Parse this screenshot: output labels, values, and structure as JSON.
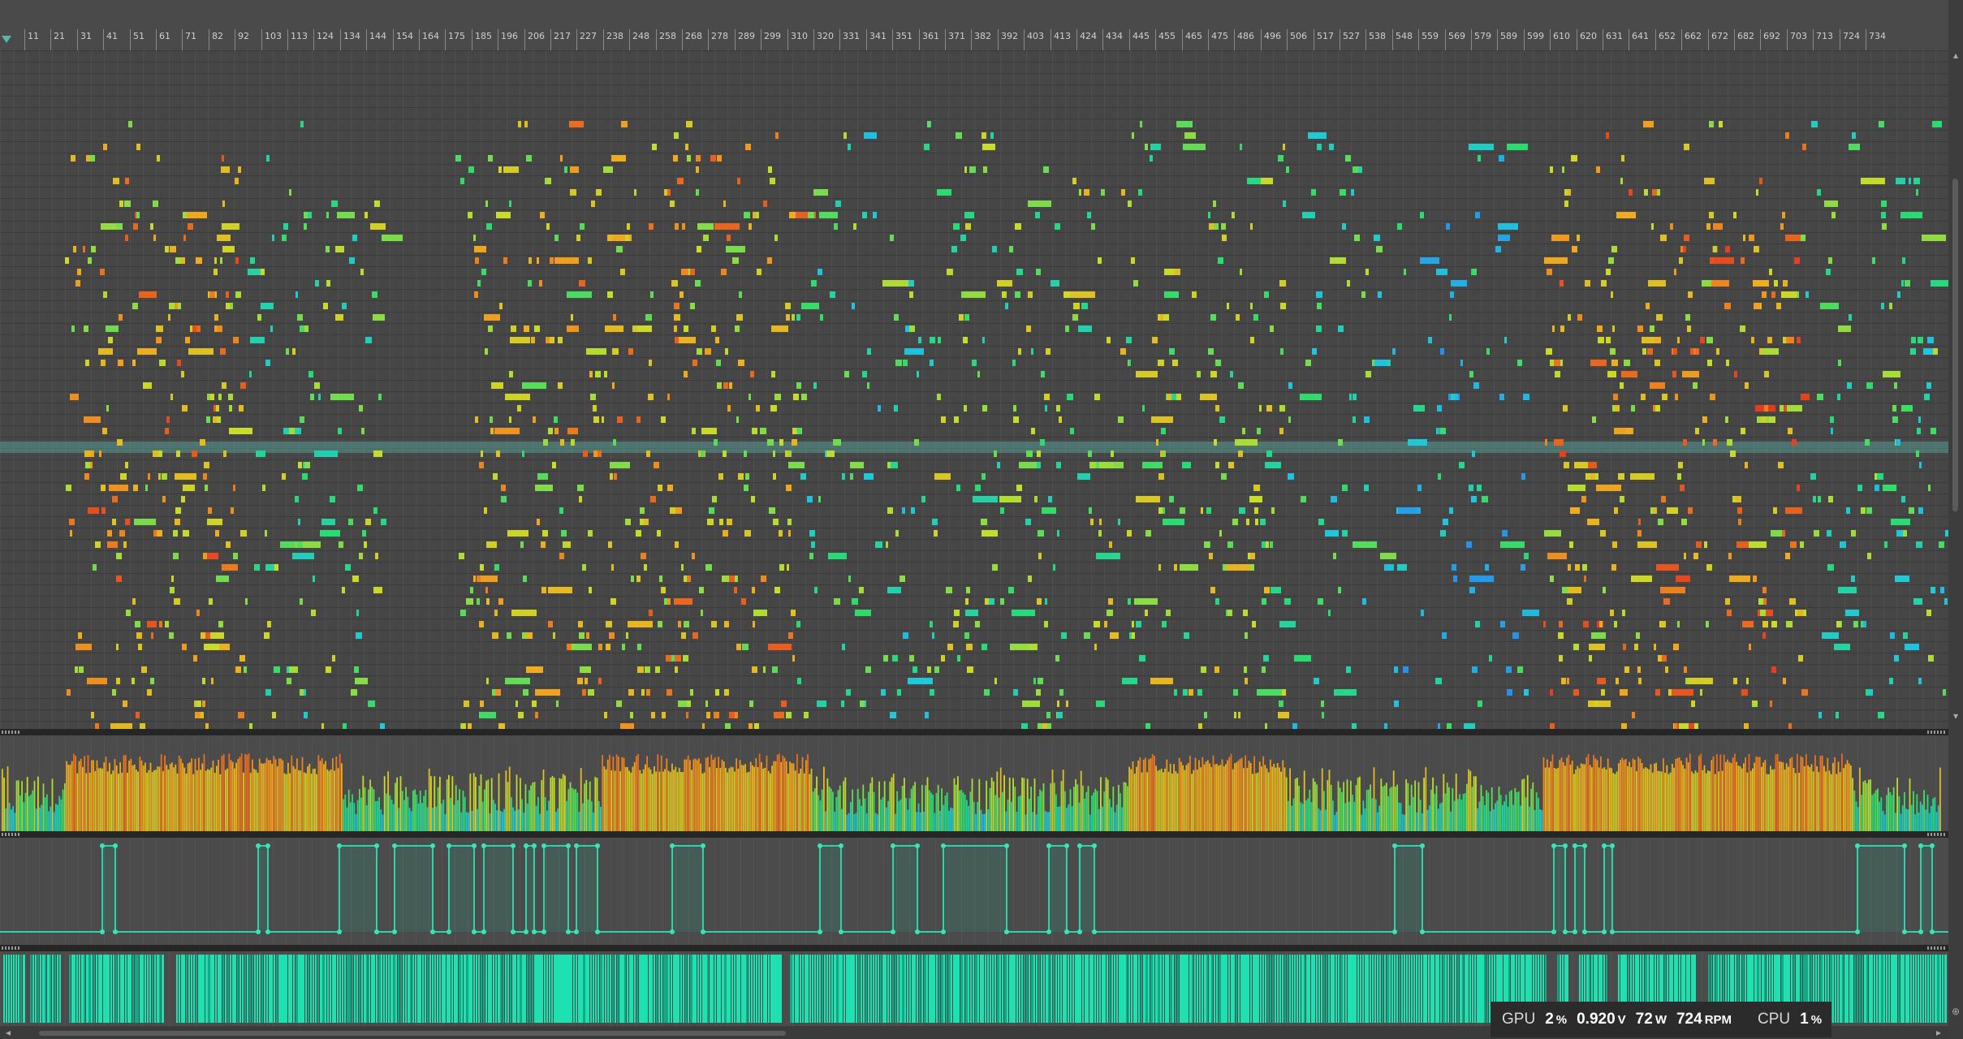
{
  "timeline": {
    "markers": [
      "11",
      "21",
      "31",
      "41",
      "51",
      "61",
      "71",
      "82",
      "92",
      "103",
      "113",
      "124",
      "134",
      "144",
      "154",
      "164",
      "175",
      "185",
      "196",
      "206",
      "217",
      "227",
      "238",
      "248",
      "258",
      "268",
      "278",
      "289",
      "299",
      "310",
      "320",
      "331",
      "341",
      "351",
      "361",
      "371",
      "382",
      "392",
      "403",
      "413",
      "424",
      "434",
      "445",
      "455",
      "465",
      "475",
      "486",
      "496",
      "506",
      "517",
      "527",
      "538",
      "548",
      "559",
      "569",
      "579",
      "589",
      "599",
      "610",
      "620",
      "631",
      "641",
      "652",
      "662",
      "672",
      "682",
      "692",
      "703",
      "713",
      "724",
      "734"
    ]
  },
  "hud": {
    "gpu_label": "GPU",
    "gpu_usage": "2",
    "gpu_usage_unit": "%",
    "voltage": "0.920",
    "voltage_unit": "V",
    "power": "72",
    "power_unit": "W",
    "fan": "724",
    "fan_unit": "RPM",
    "cpu_label": "CPU",
    "cpu_usage": "1",
    "cpu_usage_unit": "%"
  },
  "colors": {
    "background": "#474747",
    "lane_background": "#4b4b4b",
    "teal_accent": "#1fe0b0",
    "highlight_row": "#5aaaa0",
    "hud_background": "#2b2b2b"
  },
  "icons": {
    "playhead": "playhead-marker-icon",
    "scroll_up": "arrow-up-icon",
    "scroll_down": "arrow-down-icon",
    "scroll_left": "arrow-left-icon",
    "scroll_right": "arrow-right-icon",
    "zoom": "zoom-icon"
  }
}
